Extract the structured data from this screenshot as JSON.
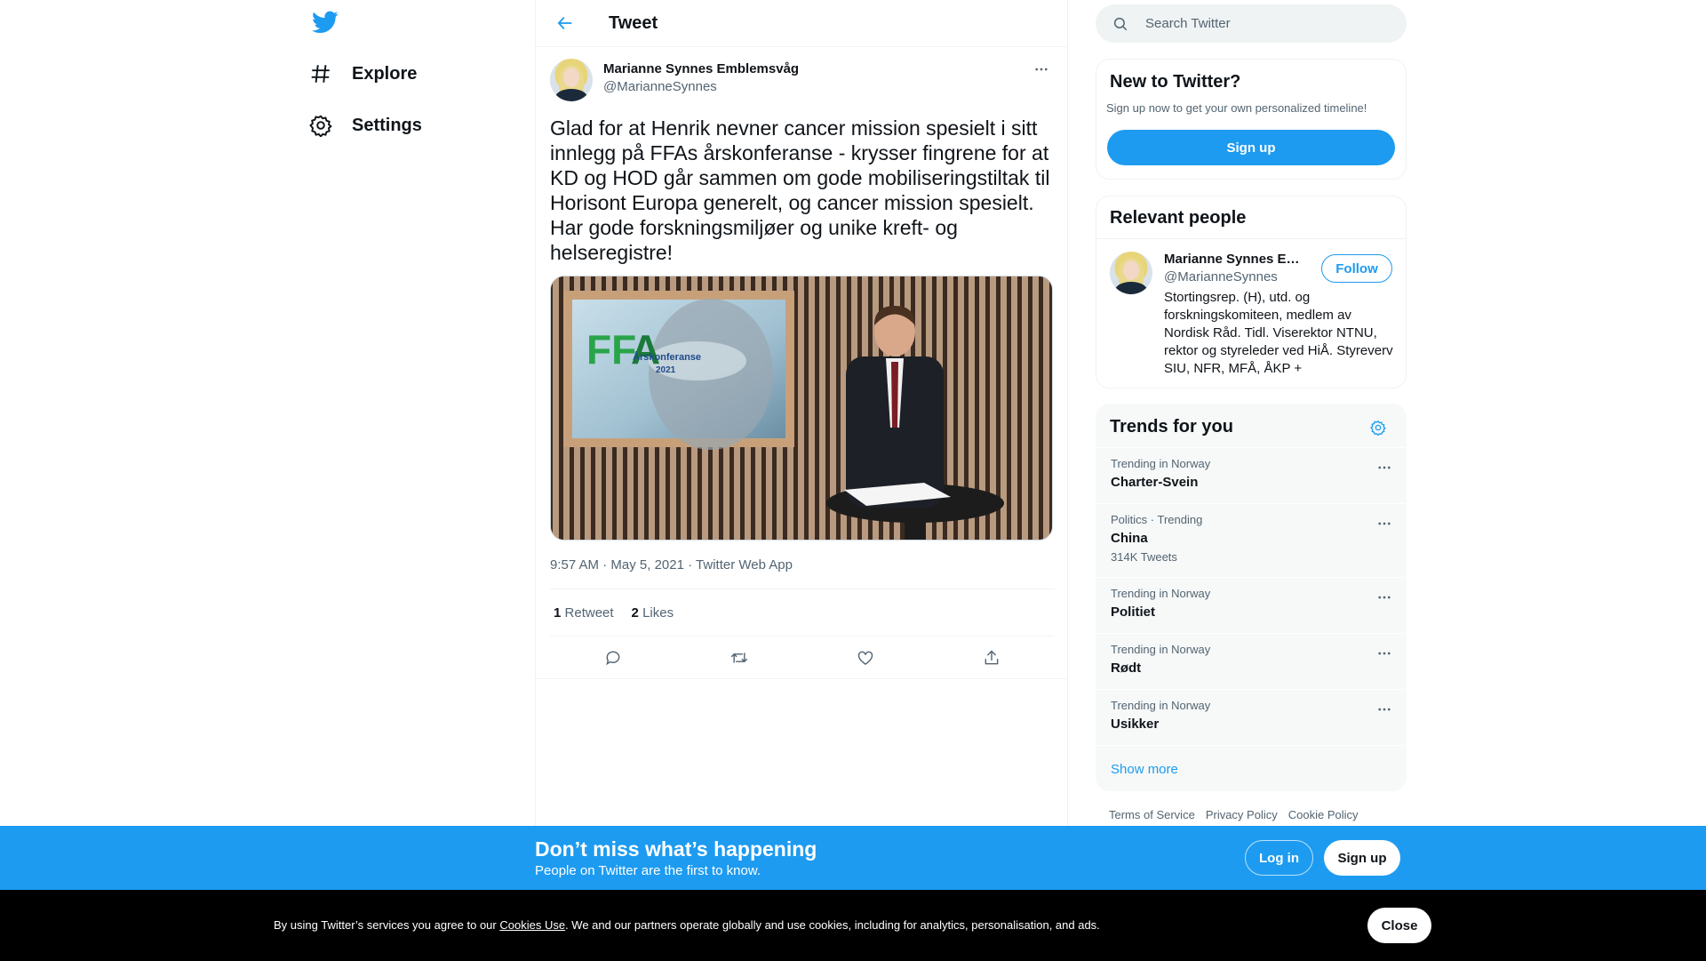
{
  "nav": {
    "logo": "twitter-bird-icon",
    "items": [
      {
        "icon": "hashtag-icon",
        "label": "Explore"
      },
      {
        "icon": "gear-icon",
        "label": "Settings"
      }
    ]
  },
  "header": {
    "back_icon": "arrow-left-icon",
    "title": "Tweet"
  },
  "tweet": {
    "author_name": "Marianne Synnes Emblemsvåg",
    "author_handle": "@MarianneSynnes",
    "text": "Glad for at Henrik nevner cancer mission spesielt i sitt innlegg på FFAs årskonferanse - krysser fingrene for at KD og HOD går sammen om gode mobiliseringstiltak til Horisont Europa generelt, og cancer mission spesielt. Har gode forskningsmiljøer og unike kreft- og helseregistre!",
    "media_caption_line1": "Årskonferanse",
    "media_caption_line2": "2021",
    "time": "9:57 AM",
    "date": "May 5, 2021",
    "source": "Twitter Web App",
    "meta_sep": "·",
    "retweets_count": "1",
    "retweets_label": "Retweet",
    "likes_count": "2",
    "likes_label": "Likes",
    "actions": [
      "reply-icon",
      "retweet-icon",
      "like-icon",
      "share-icon"
    ]
  },
  "search": {
    "placeholder": "Search Twitter"
  },
  "new_to_twitter": {
    "title": "New to Twitter?",
    "subtitle": "Sign up now to get your own personalized timeline!",
    "button": "Sign up"
  },
  "relevant_people": {
    "title": "Relevant people",
    "name": "Marianne Synnes E…",
    "handle": "@MarianneSynnes",
    "follow": "Follow",
    "bio": "Stortingsrep. (H), utd. og forskningskomiteen, medlem av Nordisk Råd. Tidl. Viserektor NTNU, rektor og styreleder ved HiÅ. Styreverv SIU, NFR, MFÅ, ÅKP +"
  },
  "trends": {
    "title": "Trends for you",
    "items": [
      {
        "context": "Trending in Norway",
        "name": "Charter-Svein",
        "count": ""
      },
      {
        "context": "Politics · Trending",
        "name": "China",
        "count": "314K Tweets"
      },
      {
        "context": "Trending in Norway",
        "name": "Politiet",
        "count": ""
      },
      {
        "context": "Trending in Norway",
        "name": "Rødt",
        "count": ""
      },
      {
        "context": "Trending in Norway",
        "name": "Usikker",
        "count": ""
      }
    ],
    "show_more": "Show more"
  },
  "footer": {
    "links": [
      "Terms of Service",
      "Privacy Policy",
      "Cookie Policy"
    ]
  },
  "promo": {
    "title": "Don’t miss what’s happening",
    "subtitle": "People on Twitter are the first to know.",
    "login": "Log in",
    "signup": "Sign up"
  },
  "cookie": {
    "prefix": "By using Twitter’s services you agree to our ",
    "link": "Cookies Use",
    "suffix": ". We and our partners operate globally and use cookies, including for analytics, personalisation, and ads.",
    "close": "Close"
  },
  "colors": {
    "accent": "#1d9bf0",
    "text": "#0f1419",
    "muted": "#536471",
    "cookie_bg": "#000000"
  }
}
